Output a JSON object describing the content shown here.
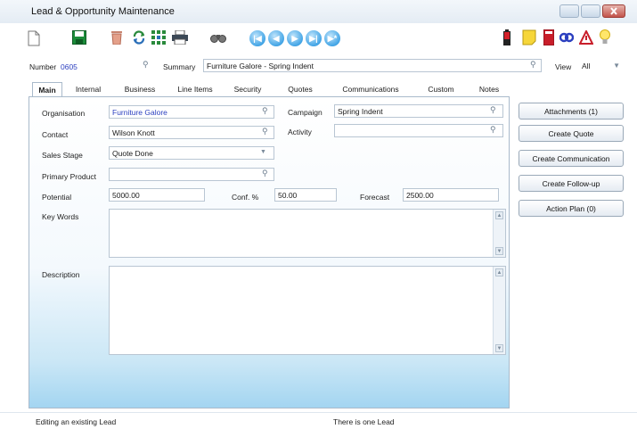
{
  "window": {
    "title": "Lead & Opportunity Maintenance"
  },
  "toolbar": {
    "icons": [
      "new-document-icon",
      "save-icon",
      "delete-icon",
      "refresh-icon",
      "grid-icon",
      "print-icon",
      "binoculars-icon",
      "nav-first-icon",
      "nav-prev-icon",
      "nav-next-icon",
      "nav-last-icon",
      "battery-icon",
      "note-icon",
      "book-icon",
      "link-icon",
      "alert-icon",
      "lightbulb-icon"
    ]
  },
  "header": {
    "number_label": "Number",
    "number_value": "0605",
    "summary_label": "Summary",
    "summary_value": "Furniture Galore - Spring Indent",
    "view_label": "View",
    "view_value": "All"
  },
  "tabs": [
    "Main",
    "Internal",
    "Business",
    "Line Items",
    "Security",
    "Quotes",
    "Communications",
    "Custom",
    "Notes"
  ],
  "form": {
    "organisation_label": "Organisation",
    "organisation_value": "Furniture Galore",
    "campaign_label": "Campaign",
    "campaign_value": "Spring Indent",
    "contact_label": "Contact",
    "contact_value": "Wilson Knott",
    "activity_label": "Activity",
    "activity_value": "",
    "sales_stage_label": "Sales Stage",
    "sales_stage_value": "Quote Done",
    "primary_product_label": "Primary Product",
    "primary_product_value": "",
    "potential_label": "Potential",
    "potential_value": "5000.00",
    "conf_label": "Conf. %",
    "conf_value": "50.00",
    "forecast_label": "Forecast",
    "forecast_value": "2500.00",
    "key_words_label": "Key Words",
    "description_label": "Description"
  },
  "actions": {
    "attachments": "Attachments (1)",
    "create_quote": "Create Quote",
    "create_communication": "Create Communication",
    "create_follow_up": "Create Follow-up",
    "action_plan": "Action Plan (0)"
  },
  "status": {
    "left": "Editing an existing Lead",
    "center": "There is one Lead"
  },
  "colors": {
    "link_blue": "#2b3fbf",
    "accent_blue": "#43a5e6",
    "panel_bottom": "#a3d5f1"
  }
}
